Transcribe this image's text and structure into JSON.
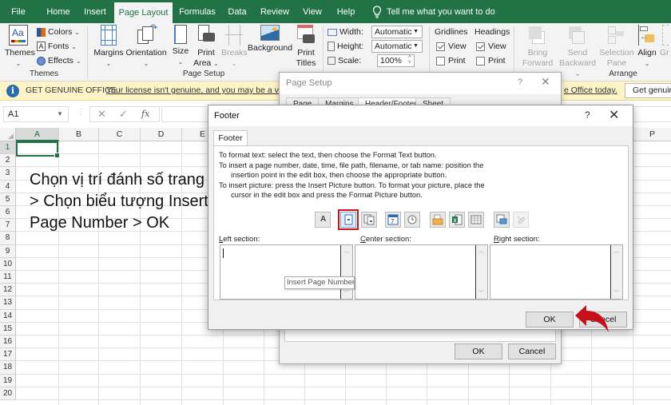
{
  "ribbon_tabs": [
    "File",
    "Home",
    "Insert",
    "Page Layout",
    "Formulas",
    "Data",
    "Review",
    "View",
    "Help"
  ],
  "active_tab": "Page Layout",
  "tell_me": "Tell me what you want to do",
  "themes_group": {
    "label": "Themes",
    "themes": "Themes",
    "colors": "Colors",
    "fonts": "Fonts",
    "effects": "Effects"
  },
  "page_setup_group": {
    "label": "Page Setup",
    "margins": "Margins",
    "orientation": "Orientation",
    "size": "Size",
    "print_area": [
      "Print",
      "Area"
    ],
    "breaks": "Breaks",
    "background": "Background",
    "print_titles": [
      "Print",
      "Titles"
    ]
  },
  "scale_group": {
    "width_label": "Width:",
    "width_value": "Automatic",
    "height_label": "Height:",
    "height_value": "Automatic",
    "scale_label": "Scale:",
    "scale_value": "100%"
  },
  "sheet_options": {
    "gridlines": "Gridlines",
    "headings": "Headings",
    "view": "View",
    "print": "Print",
    "gridlines_view": true,
    "gridlines_print": false,
    "headings_view": true,
    "headings_print": false
  },
  "arrange_group": {
    "label": "Arrange",
    "bring_forward": [
      "Bring",
      "Forward"
    ],
    "send_backward": [
      "Send",
      "Backward"
    ],
    "selection_pane": [
      "Selection",
      "Pane"
    ],
    "align": "Align",
    "group": "Gr"
  },
  "banner": {
    "title": "GET GENUINE OFFICE",
    "message_left": "Your license isn't genuine, and you may be a victim",
    "message_right": "e Office today.",
    "button": "Get genuine"
  },
  "name_box": "A1",
  "fx": "fx",
  "columns": [
    "A",
    "B",
    "C",
    "D",
    "E"
  ],
  "right_column": "P",
  "rows": [
    "1",
    "2",
    "3",
    "4",
    "5",
    "6",
    "7",
    "8",
    "9",
    "10",
    "11",
    "12",
    "13",
    "14",
    "15",
    "16",
    "17",
    "18",
    "19",
    "20"
  ],
  "annotation": "Chọn vị trí đánh số trang > Chọn biểu tượng Insert Page Number > OK",
  "page_setup_dialog": {
    "title": "Page Setup",
    "help": "?",
    "tabs": [
      "Page",
      "Margins",
      "Header/Footer",
      "Sheet"
    ],
    "active_tab": "Header/Footer",
    "ok": "OK",
    "cancel": "Cancel"
  },
  "footer_dialog": {
    "title": "Footer",
    "help": "?",
    "tab": "Footer",
    "instructions": [
      "To format text:  select the text, then choose the Format Text button.",
      "To insert a page number, date, time, file path, filename, or tab name:  position the",
      "insertion point in the edit box, then choose the appropriate button.",
      "To insert picture: press the Insert Picture button.  To format your picture, place the",
      "cursor in the edit box and press the Format Picture button."
    ],
    "toolbar_buttons": [
      {
        "icon": "format-text",
        "label": "A"
      },
      {
        "icon": "insert-page-number",
        "highlighted": true
      },
      {
        "icon": "insert-number-of-pages"
      },
      {
        "icon": "insert-date"
      },
      {
        "icon": "insert-time"
      },
      {
        "icon": "insert-file-path"
      },
      {
        "icon": "insert-file-name"
      },
      {
        "icon": "insert-sheet-name"
      },
      {
        "icon": "insert-picture"
      },
      {
        "icon": "format-picture"
      }
    ],
    "tooltip": "Insert Page Number",
    "left_section": {
      "accel": "L",
      "rest": "eft section:",
      "value": ""
    },
    "center_section": {
      "accel": "C",
      "rest": "enter section:",
      "value": ""
    },
    "right_section": {
      "accel": "R",
      "rest": "ight section:",
      "value": ""
    },
    "ok": "OK",
    "cancel": "Cancel"
  }
}
